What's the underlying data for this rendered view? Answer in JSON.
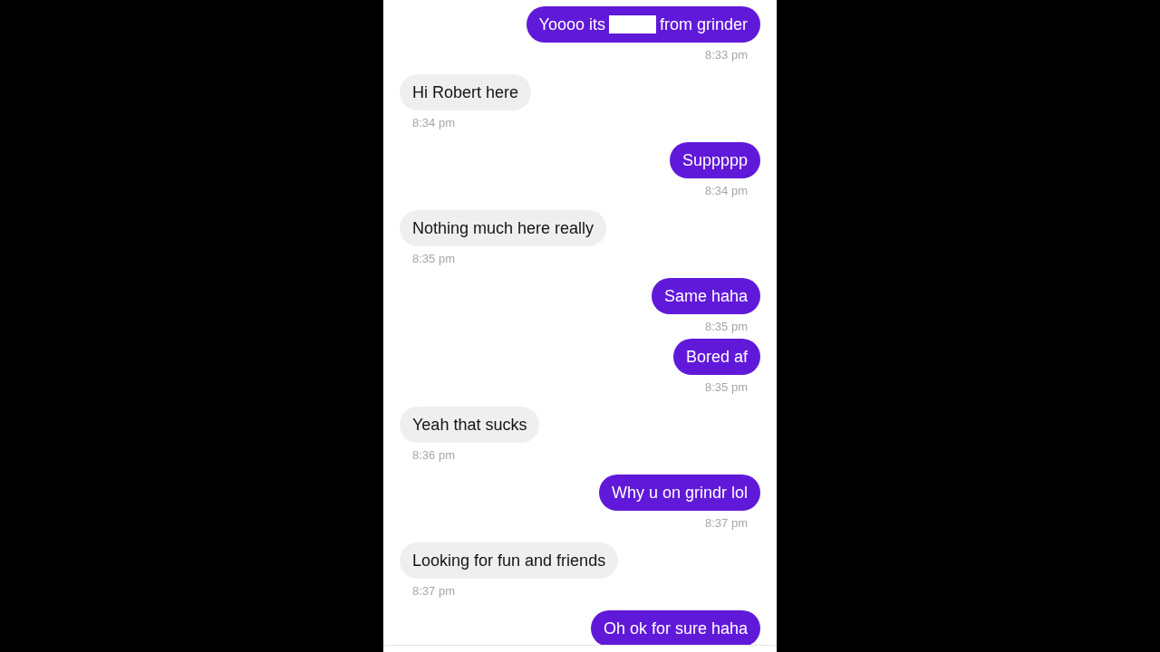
{
  "messages": [
    {
      "outgoing": true,
      "parts": [
        {
          "kind": "text",
          "text": "Yoooo its"
        },
        {
          "kind": "redaction"
        },
        {
          "kind": "text",
          "text": "from grinder"
        }
      ],
      "time": "8:33 pm"
    },
    {
      "outgoing": false,
      "parts": [
        {
          "kind": "text",
          "text": "Hi Robert here"
        }
      ],
      "time": "8:34 pm"
    },
    {
      "outgoing": true,
      "parts": [
        {
          "kind": "text",
          "text": "Suppppp"
        }
      ],
      "time": "8:34 pm"
    },
    {
      "outgoing": false,
      "parts": [
        {
          "kind": "text",
          "text": "Nothing much here really"
        }
      ],
      "time": "8:35 pm"
    },
    {
      "outgoing": true,
      "parts": [
        {
          "kind": "text",
          "text": "Same haha"
        }
      ],
      "time": "8:35 pm"
    },
    {
      "outgoing": true,
      "parts": [
        {
          "kind": "text",
          "text": "Bored af"
        }
      ],
      "time": "8:35 pm"
    },
    {
      "outgoing": false,
      "parts": [
        {
          "kind": "text",
          "text": "Yeah that sucks"
        }
      ],
      "time": "8:36 pm"
    },
    {
      "outgoing": true,
      "parts": [
        {
          "kind": "text",
          "text": "Why u on grindr lol"
        }
      ],
      "time": "8:37 pm"
    },
    {
      "outgoing": false,
      "parts": [
        {
          "kind": "text",
          "text": "Looking for fun and friends"
        }
      ],
      "time": "8:37 pm"
    },
    {
      "outgoing": true,
      "parts": [
        {
          "kind": "text",
          "text": "Oh ok for sure haha"
        }
      ]
    }
  ]
}
